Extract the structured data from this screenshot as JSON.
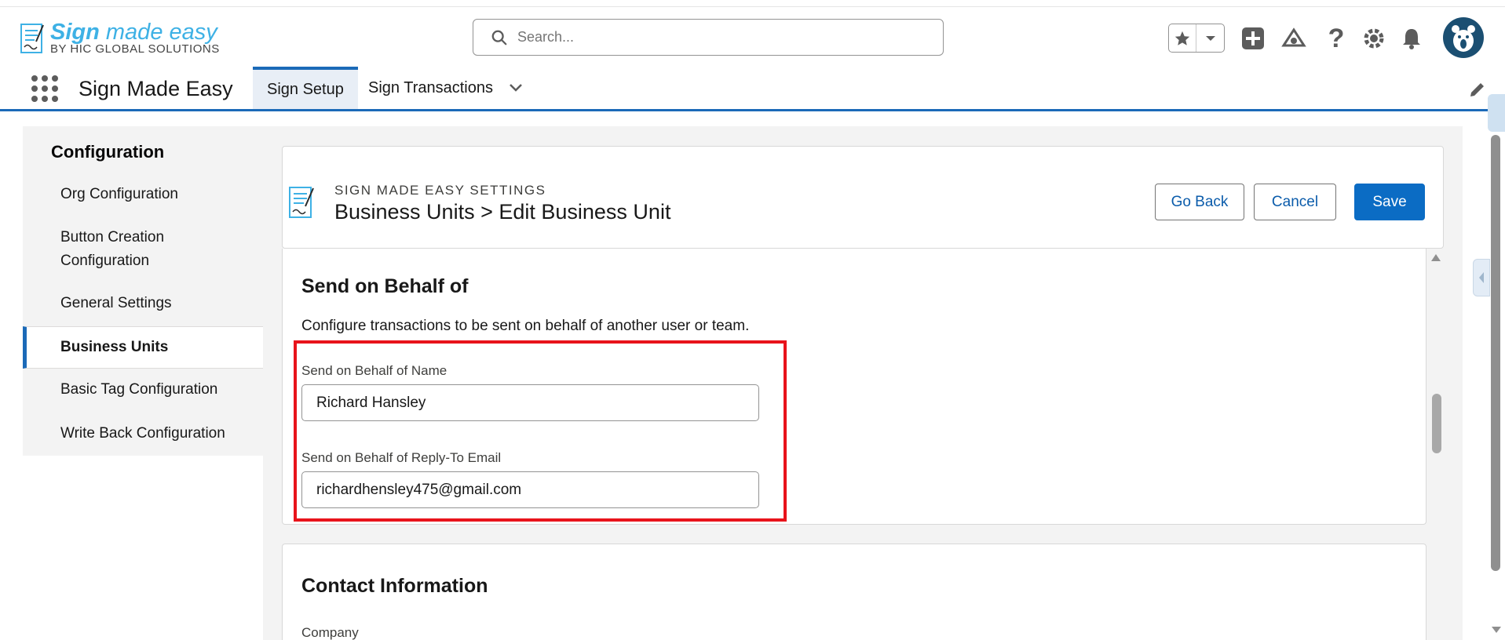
{
  "header": {
    "logo_title_bold": "Sign",
    "logo_title_light": " made easy",
    "logo_subtitle": "BY HIC GLOBAL SOLUTIONS",
    "search_placeholder": "Search..."
  },
  "nav": {
    "app_name": "Sign Made Easy",
    "tabs": [
      {
        "label": "Sign Setup",
        "active": true
      },
      {
        "label": "Sign Transactions",
        "active": false
      }
    ]
  },
  "sidebar": {
    "title": "Configuration",
    "items": [
      {
        "label": "Org Configuration"
      },
      {
        "label": "Button Creation Configuration"
      },
      {
        "label": "General Settings"
      },
      {
        "label": "Business Units",
        "active": true
      },
      {
        "label": "Basic Tag Configuration"
      },
      {
        "label": "Write Back Configuration"
      }
    ]
  },
  "settings_header": {
    "eyebrow": "SIGN MADE EASY SETTINGS",
    "title": "Business Units > Edit Business Unit",
    "go_back_label": "Go Back",
    "cancel_label": "Cancel",
    "save_label": "Save"
  },
  "send_on_behalf": {
    "title": "Send on Behalf of",
    "description": "Configure transactions to be sent on behalf of another user or team.",
    "name_label": "Send on Behalf of Name",
    "name_value": "Richard  Hansley",
    "email_label": "Send on Behalf of Reply-To Email",
    "email_value": "richardhensley475@gmail.com"
  },
  "contact": {
    "title": "Contact Information",
    "company_label": "Company"
  },
  "colors": {
    "brand": "#0b6cc4",
    "highlight": "#e8131b",
    "logo_blue": "#3eb1e5"
  }
}
